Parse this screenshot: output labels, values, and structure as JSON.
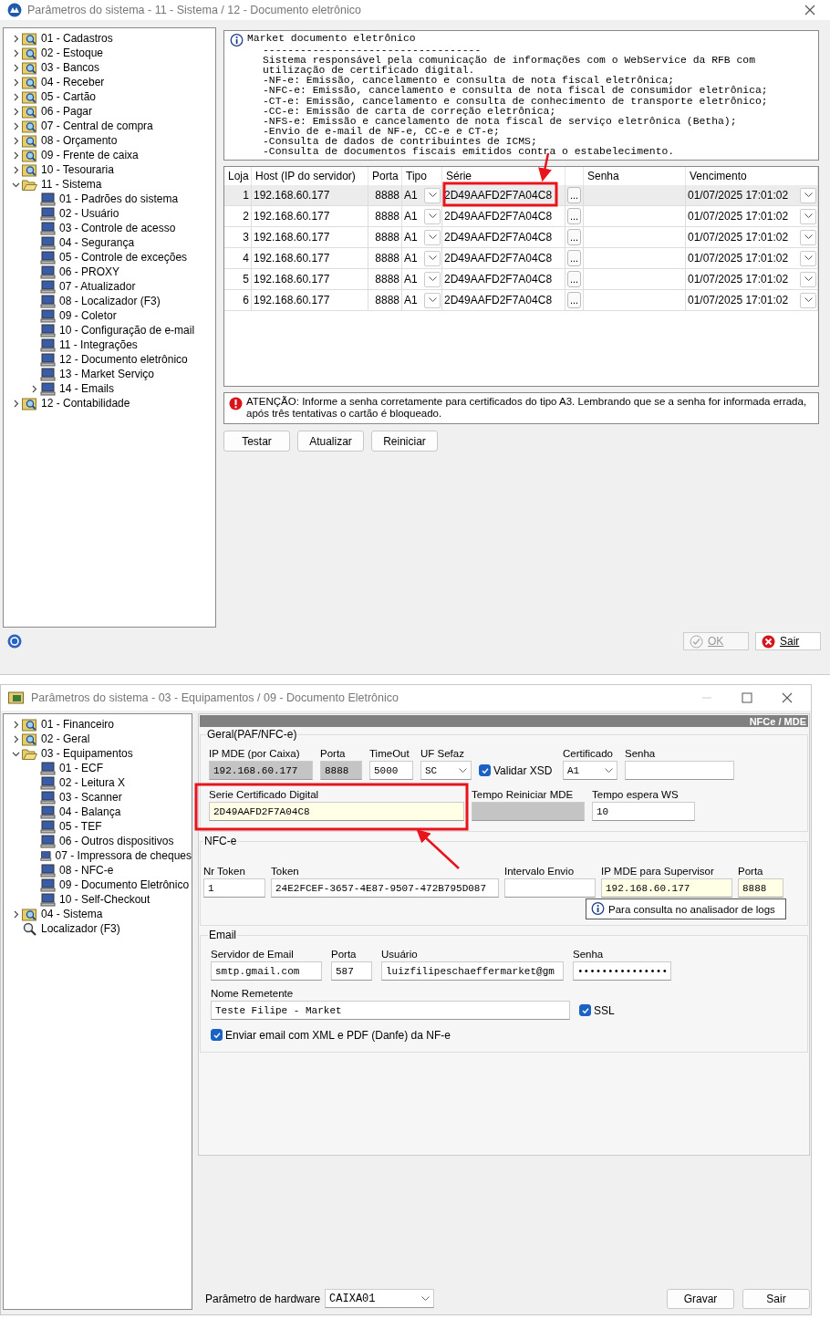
{
  "main_window": {
    "title": "Parâmetros do sistema - 11 - Sistema / 12 - Documento eletrônico",
    "tree": [
      {
        "label": "01 - Cadastros",
        "kind": "group",
        "expanded": false
      },
      {
        "label": "02 - Estoque",
        "kind": "group",
        "expanded": false
      },
      {
        "label": "03 - Bancos",
        "kind": "group",
        "expanded": false
      },
      {
        "label": "04 - Receber",
        "kind": "group",
        "expanded": false
      },
      {
        "label": "05 - Cartão",
        "kind": "group",
        "expanded": false
      },
      {
        "label": "06 - Pagar",
        "kind": "group",
        "expanded": false
      },
      {
        "label": "07 - Central de compra",
        "kind": "group",
        "expanded": false
      },
      {
        "label": "08 - Orçamento",
        "kind": "group",
        "expanded": false
      },
      {
        "label": "09 - Frente de caixa",
        "kind": "group",
        "expanded": false
      },
      {
        "label": "10 - Tesouraria",
        "kind": "group",
        "expanded": false
      },
      {
        "label": "11 - Sistema",
        "kind": "group",
        "expanded": true,
        "children": [
          {
            "label": "01 - Padrões do sistema",
            "kind": "item"
          },
          {
            "label": "02 - Usuário",
            "kind": "item"
          },
          {
            "label": "03 - Controle de acesso",
            "kind": "item"
          },
          {
            "label": "04 - Segurança",
            "kind": "item"
          },
          {
            "label": "05 - Controle de exceções",
            "kind": "item"
          },
          {
            "label": "06 - PROXY",
            "kind": "item"
          },
          {
            "label": "07 - Atualizador",
            "kind": "item"
          },
          {
            "label": "08 - Localizador (F3)",
            "kind": "item"
          },
          {
            "label": "09 - Coletor",
            "kind": "item"
          },
          {
            "label": "10 - Configuração de e-mail",
            "kind": "item"
          },
          {
            "label": "11 - Integrações",
            "kind": "item"
          },
          {
            "label": "12 - Documento eletrônico",
            "kind": "item"
          },
          {
            "label": "13 - Market Serviço",
            "kind": "item"
          },
          {
            "label": "14 - Emails",
            "kind": "item",
            "expanded": false
          }
        ]
      },
      {
        "label": "12 - Contabilidade",
        "kind": "group",
        "expanded": false
      }
    ],
    "info": {
      "title": "Market documento eletrônico",
      "separator": "-----------------------------------",
      "lines": [
        "Sistema responsável pela comunicação de informações com o WebService da RFB com",
        "utilização de certificado digital.",
        "-NF-e: Emissão, cancelamento e consulta de nota fiscal eletrônica;",
        "-NFC-e: Emissão, cancelamento e consulta de nota fiscal de consumidor eletrônica;",
        "-CT-e: Emissão, cancelamento e consulta de conhecimento de transporte eletrônico;",
        "-CC-e: Emissão de carta de correção eletrônica;",
        "-NFS-e: Emissão e cancelamento de nota fiscal de serviço eletrônica (Betha);",
        "-Envio de e-mail de NF-e, CC-e e CT-e;",
        "-Consulta de dados de contribuintes de ICMS;",
        "-Consulta de documentos fiscais emitidos contra o estabelecimento."
      ]
    },
    "table": {
      "columns": [
        "Loja",
        "Host (IP do servidor)",
        "Porta",
        "Tipo",
        "Série",
        "Senha",
        "Vencimento"
      ],
      "rows": [
        {
          "loja": "1",
          "host": "192.168.60.177",
          "porta": "8888",
          "tipo": "A1",
          "serie": "2D49AAFD2F7A04C8",
          "browse": "...",
          "vencimento": "01/07/2025 17:01:02",
          "selected": true
        },
        {
          "loja": "2",
          "host": "192.168.60.177",
          "porta": "8888",
          "tipo": "A1",
          "serie": "2D49AAFD2F7A04C8",
          "browse": "...",
          "vencimento": "01/07/2025 17:01:02",
          "selected": false
        },
        {
          "loja": "3",
          "host": "192.168.60.177",
          "porta": "8888",
          "tipo": "A1",
          "serie": "2D49AAFD2F7A04C8",
          "browse": "...",
          "vencimento": "01/07/2025 17:01:02",
          "selected": false
        },
        {
          "loja": "4",
          "host": "192.168.60.177",
          "porta": "8888",
          "tipo": "A1",
          "serie": "2D49AAFD2F7A04C8",
          "browse": "...",
          "vencimento": "01/07/2025 17:01:02",
          "selected": false
        },
        {
          "loja": "5",
          "host": "192.168.60.177",
          "porta": "8888",
          "tipo": "A1",
          "serie": "2D49AAFD2F7A04C8",
          "browse": "...",
          "vencimento": "01/07/2025 17:01:02",
          "selected": false
        },
        {
          "loja": "6",
          "host": "192.168.60.177",
          "porta": "8888",
          "tipo": "A1",
          "serie": "2D49AAFD2F7A04C8",
          "browse": "...",
          "vencimento": "01/07/2025 17:01:02",
          "selected": false
        }
      ]
    },
    "warning": "ATENÇÃO: Informe a senha corretamente para certificados do tipo A3. Lembrando que se a senha for informada errada, após três tentativas o cartão é bloqueado.",
    "actions": [
      "Testar",
      "Atualizar",
      "Reiniciar"
    ],
    "footer_buttons": [
      {
        "label": "OK",
        "kind": "confirm",
        "disabled": true
      },
      {
        "label": "Sair",
        "kind": "exit",
        "disabled": false
      }
    ]
  },
  "second_window": {
    "title": "Parâmetros do sistema - 03 - Equipamentos / 09 - Documento Eletrônico",
    "tree": [
      {
        "label": "01 - Financeiro",
        "kind": "group",
        "expanded": false
      },
      {
        "label": "02 - Geral",
        "kind": "group",
        "expanded": false
      },
      {
        "label": "03 - Equipamentos",
        "kind": "group",
        "expanded": true,
        "children": [
          {
            "label": "01 - ECF",
            "kind": "item"
          },
          {
            "label": "02 - Leitura X",
            "kind": "item"
          },
          {
            "label": "03 - Scanner",
            "kind": "item"
          },
          {
            "label": "04 - Balança",
            "kind": "item"
          },
          {
            "label": "05 - TEF",
            "kind": "item"
          },
          {
            "label": "06 - Outros dispositivos",
            "kind": "item"
          },
          {
            "label": "07 - Impressora de cheques",
            "kind": "item"
          },
          {
            "label": "08 - NFC-e",
            "kind": "item"
          },
          {
            "label": "09 - Documento Eletrônico",
            "kind": "item"
          },
          {
            "label": "10 - Self-Checkout",
            "kind": "item"
          }
        ]
      },
      {
        "label": "04 - Sistema",
        "kind": "group",
        "expanded": false
      },
      {
        "label": "Localizador (F3)",
        "kind": "search"
      }
    ],
    "header": "NFCe / MDE",
    "groups": [
      {
        "title": "Geral(PAF/NFC-e)",
        "rows": [
          {
            "fields": [
              {
                "label": "IP MDE (por Caixa)",
                "value": "192.168.60.177",
                "kind": "readonly"
              },
              {
                "label": "Porta",
                "value": "8888",
                "kind": "readonly"
              },
              {
                "label": "TimeOut",
                "value": "5000",
                "kind": "input"
              },
              {
                "label": "UF Sefaz",
                "value": "SC",
                "kind": "select"
              },
              {
                "label": "Validar XSD",
                "kind": "check",
                "checked": true
              },
              {
                "label": "Certificado",
                "value": "A1",
                "kind": "select"
              },
              {
                "label": "Senha",
                "kind": "input"
              }
            ]
          },
          {
            "fields": [
              {
                "label": "Serie Certificado Digital",
                "value": "2D49AAFD2F7A04C8",
                "kind": "highlight"
              },
              {
                "label": "Tempo Reiniciar MDE",
                "kind": "readonly"
              },
              {
                "label": "Tempo espera WS",
                "value": "10",
                "kind": "input"
              }
            ]
          }
        ]
      },
      {
        "title": "NFC-e",
        "rows": [
          {
            "fields": [
              {
                "label": "Nr Token",
                "value": "1",
                "kind": "input"
              },
              {
                "label": "Token",
                "value": "24E2FCEF-3657-4E87-9507-472B795D087",
                "kind": "input"
              },
              {
                "label": "Intervalo Envio",
                "kind": "input"
              },
              {
                "label": "IP MDE para Supervisor",
                "value": "192.168.60.177",
                "kind": "highlight"
              },
              {
                "label": "Porta",
                "value": "8888",
                "kind": "highlight"
              }
            ]
          }
        ],
        "note": "Para consulta no analisador de logs"
      },
      {
        "title": "Email",
        "rows": [
          {
            "fields": [
              {
                "label": "Servidor de Email",
                "value": "smtp.gmail.com",
                "kind": "input"
              },
              {
                "label": "Porta",
                "value": "587",
                "kind": "input"
              },
              {
                "label": "Usuário",
                "value": "luizfilipeschaeffermarket@gm",
                "kind": "input"
              },
              {
                "label": "Senha",
                "value": "•••••••••••••••",
                "kind": "input"
              }
            ]
          },
          {
            "fields": [
              {
                "label": "Nome Remetente",
                "value": "Teste Filipe - Market",
                "kind": "input"
              },
              {
                "label": "SSL",
                "kind": "check",
                "checked": true
              }
            ]
          },
          {
            "fields": [
              {
                "label": "Enviar email com XML e PDF (Danfe) da NF-e",
                "kind": "check",
                "checked": true
              }
            ]
          }
        ]
      }
    ],
    "hardware": {
      "label": "Parâmetro de hardware",
      "value": "CAIXA01"
    },
    "buttons": [
      "Gravar",
      "Sair"
    ]
  }
}
